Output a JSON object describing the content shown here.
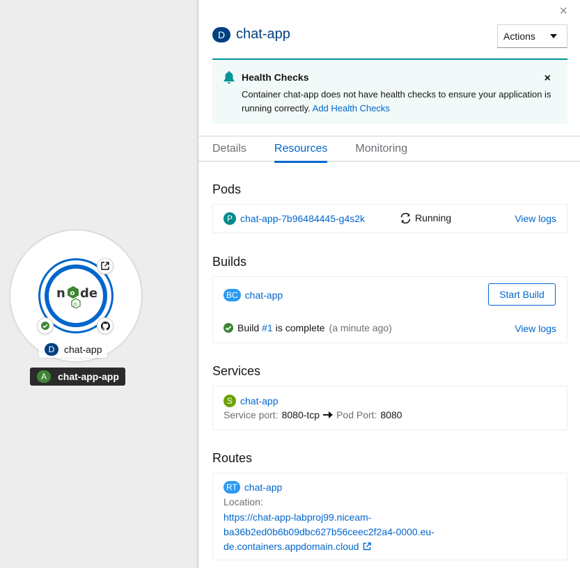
{
  "topology": {
    "node_badge": "D",
    "node_name": "chat-app",
    "app_badge": "A",
    "app_name": "chat-app-app",
    "node_logo_text": "node"
  },
  "panel": {
    "close": "×",
    "header_badge": "D",
    "title": "chat-app",
    "actions_label": "Actions",
    "alert": {
      "title": "Health Checks",
      "text": "Container chat-app does not have health checks to ensure your application is running correctly.",
      "link": "Add Health Checks",
      "close": "×"
    },
    "tabs": [
      "Details",
      "Resources",
      "Monitoring"
    ],
    "active_tab": "Resources",
    "pods": {
      "title": "Pods",
      "badge": "P",
      "name": "chat-app-7b96484445-g4s2k",
      "status": "Running",
      "view_logs": "View logs"
    },
    "builds": {
      "title": "Builds",
      "badge": "BC",
      "name": "chat-app",
      "start_build": "Start Build",
      "build_prefix": "Build",
      "build_number": "#1",
      "build_suffix": "is complete",
      "build_time": "(a minute ago)",
      "view_logs": "View logs"
    },
    "services": {
      "title": "Services",
      "badge": "S",
      "name": "chat-app",
      "service_port_label": "Service port:",
      "service_port": "8080-tcp",
      "pod_port_label": "Pod Port:",
      "pod_port": "8080"
    },
    "routes": {
      "title": "Routes",
      "badge": "RT",
      "name": "chat-app",
      "location_label": "Location:",
      "url_line1": "https://chat-app-labproj99.niceam-",
      "url_line2": "ba36b2ed0b6b09dbc627b56ceec2f2a4-0000.eu-",
      "url_line3": "de.containers.appdomain.cloud"
    }
  },
  "colors": {
    "accent": "#0066cc",
    "title_blue": "#004080",
    "alert_bg": "#f2f9f9",
    "alert_border": "#009596",
    "success": "#3e8635"
  }
}
